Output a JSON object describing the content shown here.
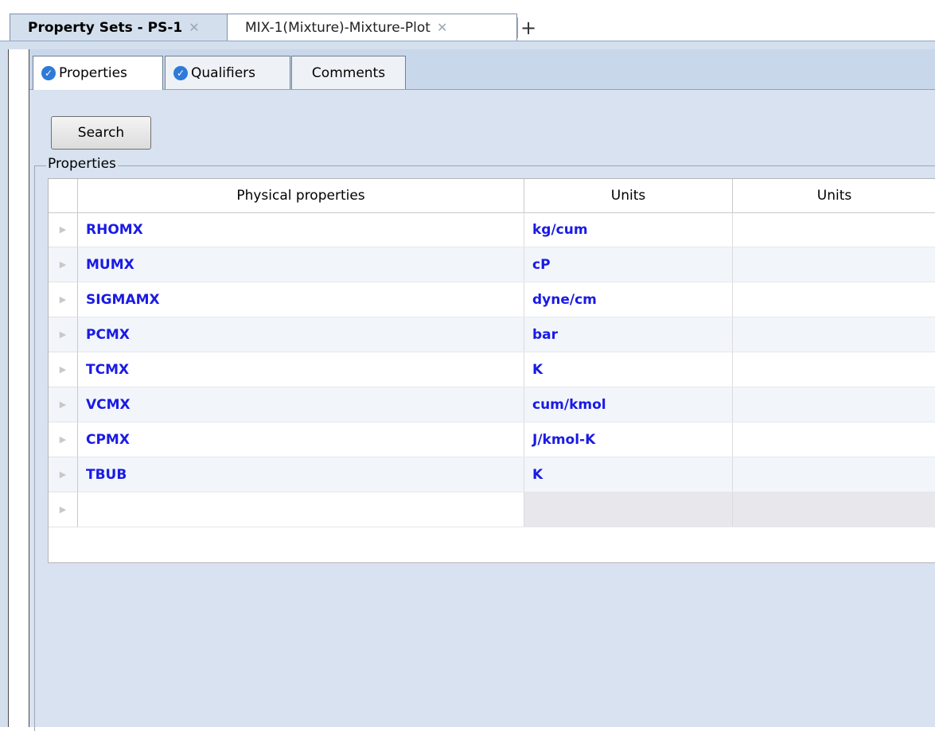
{
  "doc_tabs": [
    {
      "label": "Property Sets - PS-1",
      "active": true
    },
    {
      "label": "MIX-1(Mixture)-Mixture-Plot",
      "active": false
    }
  ],
  "add_tab_icon": "plus-icon",
  "subtabs": [
    {
      "label": "Properties",
      "checked": true,
      "active": true
    },
    {
      "label": "Qualifiers",
      "checked": true,
      "active": false
    },
    {
      "label": "Comments",
      "checked": false,
      "active": false
    }
  ],
  "search_button": "Search",
  "group_label": "Properties",
  "table": {
    "headers": [
      "Physical properties",
      "Units",
      "Units"
    ],
    "rows": [
      {
        "property": "RHOMX",
        "units": "kg/cum",
        "units2": ""
      },
      {
        "property": "MUMX",
        "units": "cP",
        "units2": ""
      },
      {
        "property": "SIGMAMX",
        "units": "dyne/cm",
        "units2": ""
      },
      {
        "property": "PCMX",
        "units": "bar",
        "units2": ""
      },
      {
        "property": "TCMX",
        "units": "K",
        "units2": ""
      },
      {
        "property": "VCMX",
        "units": "cum/kmol",
        "units2": ""
      },
      {
        "property": "CPMX",
        "units": "J/kmol-K",
        "units2": ""
      },
      {
        "property": "TBUB",
        "units": "K",
        "units2": ""
      },
      {
        "property": "",
        "units": "",
        "units2": ""
      }
    ]
  },
  "colors": {
    "accent_text": "#1a1ae6",
    "panel_bg": "#d8e2f0",
    "check_icon": "#2f7ad8"
  }
}
